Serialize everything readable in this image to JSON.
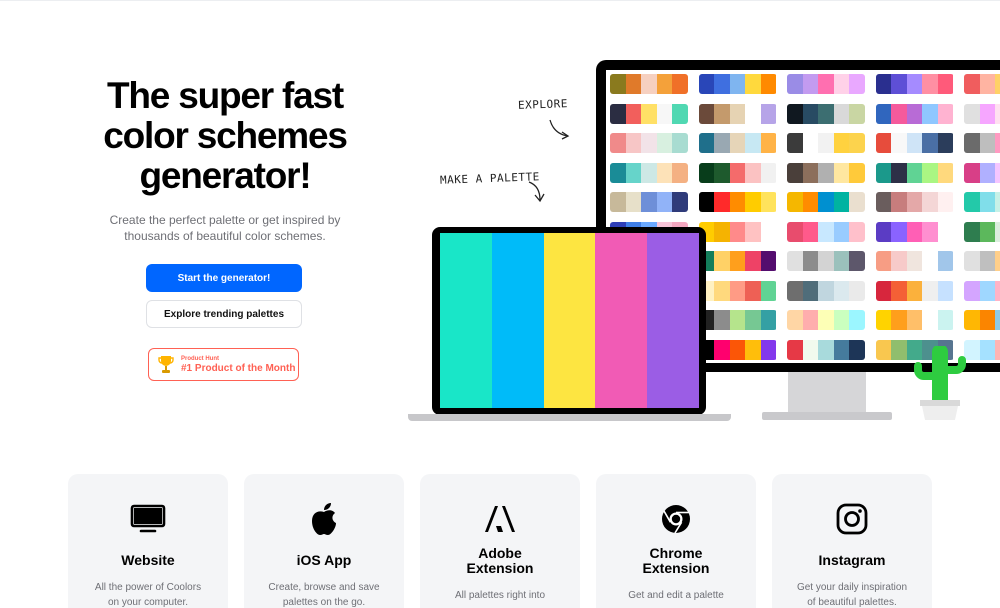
{
  "hero": {
    "title": "The super fast\ncolor schemes\ngenerator!",
    "subtitle": "Create the perfect palette or get inspired by thousands of beautiful color schemes.",
    "primary_button": "Start the generator!",
    "secondary_button": "Explore trending palettes",
    "badge": {
      "small": "Product Hunt",
      "big": "#1 Product of the Month"
    }
  },
  "annotations": {
    "explore": "EXPLORE",
    "make_palette": "MAKE A PALETTE"
  },
  "laptop_palette": [
    "#19e6c8",
    "#00bbf9",
    "#fde541",
    "#f15bb5",
    "#9b5de5"
  ],
  "monitor_palettes": [
    [
      "#8a7a1e",
      "#e07a2a",
      "#f6d0c0",
      "#f4a13a",
      "#f07028"
    ],
    [
      "#2946b8",
      "#3f6fe0",
      "#7fb5f0",
      "#ffd93d",
      "#ff8a00"
    ],
    [
      "#9a8ce6",
      "#c39bf0",
      "#ff6fb0",
      "#ffd1e8",
      "#e9a8ff"
    ],
    [
      "#2a2f8f",
      "#5e4fd6",
      "#a58bff",
      "#ff8fa3",
      "#ff5a7a"
    ],
    [
      "#f05d5e",
      "#ffb4a2",
      "#ffd166",
      "#06d6a0",
      "#118ab2"
    ],
    [
      "#2b2d42",
      "#f25f5c",
      "#ffe066",
      "#f7f7f7",
      "#50d8b2"
    ],
    [
      "#6b4a3a",
      "#c49a6c",
      "#e6d3b3",
      "#ffffff",
      "#b6a4e8"
    ],
    [
      "#101820",
      "#284b63",
      "#3c6e71",
      "#d9d9d9",
      "#c9d6a3"
    ],
    [
      "#3066be",
      "#f55a9c",
      "#b86bd6",
      "#8fc7ff",
      "#ffb3d1"
    ],
    [
      "#e0e0e0",
      "#f6a6ff",
      "#ffe0f0",
      "#ffffff",
      "#ffd1dc"
    ],
    [
      "#f08a8a",
      "#f7c6c6",
      "#f2e3e8",
      "#d8f0e0",
      "#a8dcd1"
    ],
    [
      "#1f6f8b",
      "#99a8b2",
      "#e6d5b8",
      "#c7e8f3",
      "#ffb347"
    ],
    [
      "#3b3b3b",
      "#ffffff",
      "#f2f2f2",
      "#ffd23f",
      "#fcd34d"
    ],
    [
      "#e74c3c",
      "#f8f8f8",
      "#cfe4f7",
      "#4a6fa5",
      "#2b3d5b"
    ],
    [
      "#6b6b6b",
      "#bebebe",
      "#ff9ac1",
      "#ff3d7f",
      "#e0e0e0"
    ],
    [
      "#1a8c97",
      "#66d4ca",
      "#cde8e5",
      "#fde2b8",
      "#f4b183"
    ],
    [
      "#083d1b",
      "#1e5a2d",
      "#f46b6b",
      "#fbc2c2",
      "#f1f1f1"
    ],
    [
      "#4a3f3a",
      "#8c6f5c",
      "#b0b0b0",
      "#ffe7a0",
      "#ffca3a"
    ],
    [
      "#1b998b",
      "#2d3047",
      "#60d394",
      "#aaf683",
      "#ffd97d"
    ],
    [
      "#d83f87",
      "#b0b0ff",
      "#f5c6ff",
      "#ffe0f5",
      "#ff9ed8"
    ],
    [
      "#c7b99a",
      "#e7e0c9",
      "#6e8fd8",
      "#91b3f8",
      "#2f3b7a"
    ],
    [
      "#000000",
      "#ff2a2a",
      "#ff8c00",
      "#ffcc00",
      "#ffe35c"
    ],
    [
      "#f5b700",
      "#ff8c00",
      "#0090d0",
      "#00b3a1",
      "#eadfcf"
    ],
    [
      "#6a5d5d",
      "#c77d7d",
      "#e4a8a8",
      "#f4d6d6",
      "#fff0f0"
    ],
    [
      "#23c9a9",
      "#80deea",
      "#c6f1e7",
      "#fefefe",
      "#ffd3b6"
    ],
    [
      "#2f3fb8",
      "#3f7fe8",
      "#6aa9ff",
      "#f8c4d8",
      "#f4a8c1"
    ],
    [
      "#ffcc00",
      "#f5b301",
      "#ff8a8a",
      "#ffc2c2",
      "#ffffff"
    ],
    [
      "#e84c6d",
      "#ff5a8b",
      "#c8e8ff",
      "#99ccff",
      "#ffc0cb"
    ],
    [
      "#5b3cc4",
      "#8a63ff",
      "#ff5fb5",
      "#ff8fd0",
      "#ffffff"
    ],
    [
      "#2e7d4f",
      "#5cb85c",
      "#dbeede",
      "#ffcda8",
      "#ff9f68"
    ],
    [
      "#0a1f8f",
      "#3a55d1",
      "#9fb4ff",
      "#ffc1d9",
      "#ff7aa2"
    ],
    [
      "#147e5b",
      "#ffd166",
      "#ff9f1c",
      "#ee4266",
      "#540d6e"
    ],
    [
      "#e0e0e0",
      "#8c8c8c",
      "#d3d3d3",
      "#9bc1bc",
      "#5d576b"
    ],
    [
      "#f79d84",
      "#f7cac9",
      "#f0e5de",
      "#ffffff",
      "#a1c6ea"
    ],
    [
      "#e0e0e0",
      "#bfbfbf",
      "#ffcf8a",
      "#ffae5c",
      "#ff7a5c"
    ],
    [
      "#f1948a",
      "#f5b7b1",
      "#fadbd8",
      "#fef9e7",
      "#fdebd0"
    ],
    [
      "#fff1c1",
      "#ffd97d",
      "#ff9b85",
      "#ee6055",
      "#60d394"
    ],
    [
      "#6e6e6e",
      "#4f6d7a",
      "#c0d6df",
      "#dbe9ee",
      "#eaeaea"
    ],
    [
      "#d7263d",
      "#f46036",
      "#fbb13c",
      "#efefef",
      "#c6e1ff"
    ],
    [
      "#d4a5ff",
      "#9fd7ff",
      "#ffb3c6",
      "#ffe5ec",
      "#ffffff"
    ],
    [
      "#a7c5eb",
      "#b8c0ff",
      "#e2ece9",
      "#ffcfd2",
      "#f1c0e8"
    ],
    [
      "#222222",
      "#8c8c8c",
      "#b5e48c",
      "#76c893",
      "#34a0a4"
    ],
    [
      "#ffd6a5",
      "#ffadad",
      "#fdffb6",
      "#caffbf",
      "#9bf6ff"
    ],
    [
      "#ffd300",
      "#ff9f1c",
      "#ffbf69",
      "#ffffff",
      "#cbf3f0"
    ],
    [
      "#ffb703",
      "#fb8500",
      "#8ecae6",
      "#219ebc",
      "#023047"
    ],
    [
      "#ff4d6d",
      "#ff758f",
      "#ffb3c1",
      "#ffe5ec",
      "#ffffff"
    ],
    [
      "#000000",
      "#ff006e",
      "#fb5607",
      "#ffbe0b",
      "#8338ec"
    ],
    [
      "#e63946",
      "#f1faee",
      "#a8dadc",
      "#457b9d",
      "#1d3557"
    ],
    [
      "#f9c74f",
      "#90be6d",
      "#43aa8b",
      "#4d908e",
      "#577590"
    ],
    [
      "#d2f4ff",
      "#a5e1ff",
      "#ffb4b4",
      "#ff8e8e",
      "#ffffff"
    ],
    [
      "#6a4c93",
      "#1982c4",
      "#8ac926",
      "#ffca3a",
      "#ff595e"
    ],
    [
      "#fef9ef",
      "#ffcb77",
      "#17c3b2",
      "#227c9d",
      "#fe6d73"
    ],
    [
      "#0081a7",
      "#00afb9",
      "#fdfcdc",
      "#fed9b7",
      "#f07167"
    ],
    [
      "#2b2d42",
      "#8d99ae",
      "#edf2f4",
      "#ef233c",
      "#d90429"
    ],
    [
      "#ffbe0b",
      "#fb5607",
      "#ff006e",
      "#8338ec",
      "#3a86ff"
    ],
    [
      "#f4f1de",
      "#e07a5f",
      "#3d405b",
      "#81b29a",
      "#f2cc8f"
    ],
    [
      "#ff9f1c",
      "#ffbf69",
      "#ffffff",
      "#cbf3f0",
      "#2ec4b6"
    ],
    [
      "#fec5bb",
      "#fcd5ce",
      "#fae1dd",
      "#f8edeb",
      "#e8e8e4"
    ],
    [
      "#03045e",
      "#0077b6",
      "#00b4d8",
      "#90e0ef",
      "#caf0f8"
    ],
    [
      "#d9ed92",
      "#b5e48c",
      "#99d98c",
      "#76c893",
      "#52b69a"
    ]
  ],
  "features": [
    {
      "icon": "monitor-icon",
      "title": "Website",
      "desc": "All the power of Coolors\non your computer."
    },
    {
      "icon": "apple-icon",
      "title": "iOS App",
      "desc": "Create, browse and save\npalettes on the go."
    },
    {
      "icon": "adobe-icon",
      "title": "Adobe\nExtension",
      "desc": "All palettes right into"
    },
    {
      "icon": "chrome-icon",
      "title": "Chrome\nExtension",
      "desc": "Get and edit a palette"
    },
    {
      "icon": "instagram-icon",
      "title": "Instagram",
      "desc": "Get your daily inspiration\nof beautiful palettes."
    }
  ]
}
